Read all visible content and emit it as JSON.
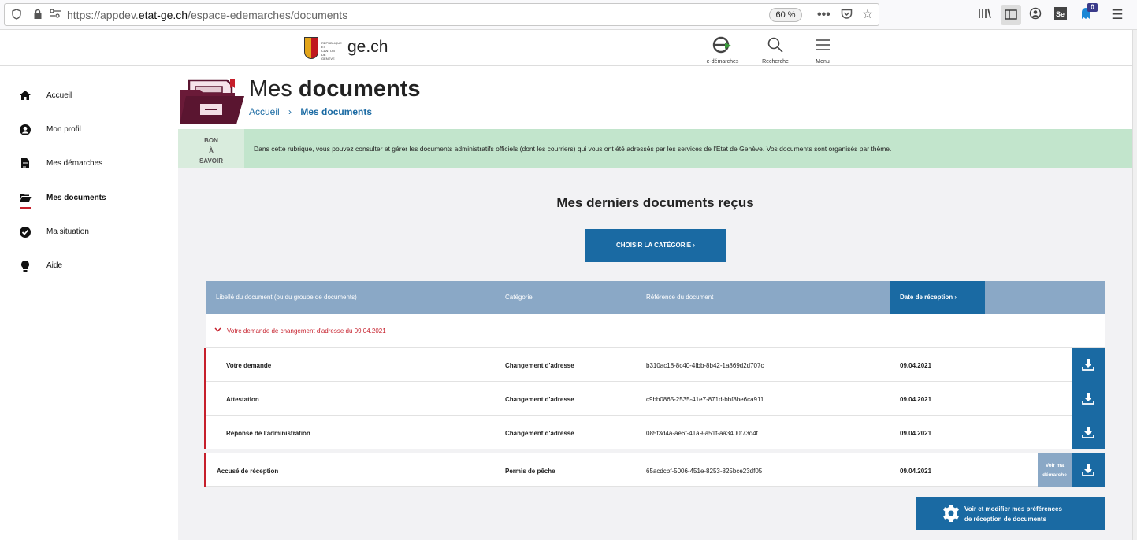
{
  "browser": {
    "url_prefix": "https://appdev.",
    "url_domain": "etat-ge.ch",
    "url_path": "/espace-edemarches/documents",
    "zoom": "60 %",
    "badge_count": "0"
  },
  "header": {
    "logo_text": "ge.ch",
    "logo_small_text": "RÉPUBLIQUE ET CANTON DE GENÈVE",
    "edemarches_label": "e-démarches",
    "recherche_label": "Recherche",
    "menu_label": "Menu"
  },
  "sidebar": {
    "items": [
      {
        "label": "Accueil",
        "icon": "home-icon"
      },
      {
        "label": "Mon profil",
        "icon": "user-icon"
      },
      {
        "label": "Mes démarches",
        "icon": "document-icon"
      },
      {
        "label": "Mes documents",
        "icon": "folder-open-icon",
        "active": true
      },
      {
        "label": "Ma situation",
        "icon": "check-circle-icon"
      },
      {
        "label": "Aide",
        "icon": "lightbulb-icon"
      }
    ]
  },
  "page": {
    "title_light": "Mes",
    "title_bold": "documents",
    "breadcrumb_home": "Accueil",
    "breadcrumb_sep": "›",
    "breadcrumb_current": "Mes documents"
  },
  "info": {
    "bon_line1": "BON",
    "bon_line2": "À",
    "bon_line3": "SAVOIR",
    "text": "Dans cette rubrique, vous pouvez consulter et gérer les documents administratifs officiels (dont les courriers) qui vous ont été adressés par les services de l'Etat de Genève. Vos documents sont organisés par thème."
  },
  "section": {
    "title": "Mes derniers documents reçus",
    "category_button": "CHOISIR LA CATÉGORIE ›"
  },
  "table": {
    "headers": {
      "libelle": "Libellé du document (ou du groupe de documents)",
      "categorie": "Catégorie",
      "reference": "Référence du document",
      "date": "Date de réception ›"
    },
    "group_title": "Votre demande de changement d'adresse du 09.04.2021",
    "rows": [
      {
        "libelle": "Votre demande",
        "categorie": "Changement d'adresse",
        "reference": "b310ac18-8c40-4fbb-8b42-1a869d2d707c",
        "date": "09.04.2021"
      },
      {
        "libelle": "Attestation",
        "categorie": "Changement d'adresse",
        "reference": "c9bb0865-2535-41e7-871d-bbf8be6ca911",
        "date": "09.04.2021"
      },
      {
        "libelle": "Réponse de l'administration",
        "categorie": "Changement d'adresse",
        "reference": "085f3d4a-ae6f-41a9-a51f-aa3400f73d4f",
        "date": "09.04.2021"
      },
      {
        "libelle": "Accusé de réception",
        "categorie": "Permis de pêche",
        "reference": "65acdcbf-5006-451e-8253-825bce23df05",
        "date": "09.04.2021"
      }
    ],
    "voir_line1": "Voir ma",
    "voir_line2": "démarche"
  },
  "preferences": {
    "line1": "Voir et modifier mes préférences",
    "line2": "de réception de documents"
  },
  "colors": {
    "primary": "#1a6aa3",
    "accent_red": "#c61f2b",
    "header_blue": "#8aa8c6",
    "info_green": "#c2e5cc"
  }
}
